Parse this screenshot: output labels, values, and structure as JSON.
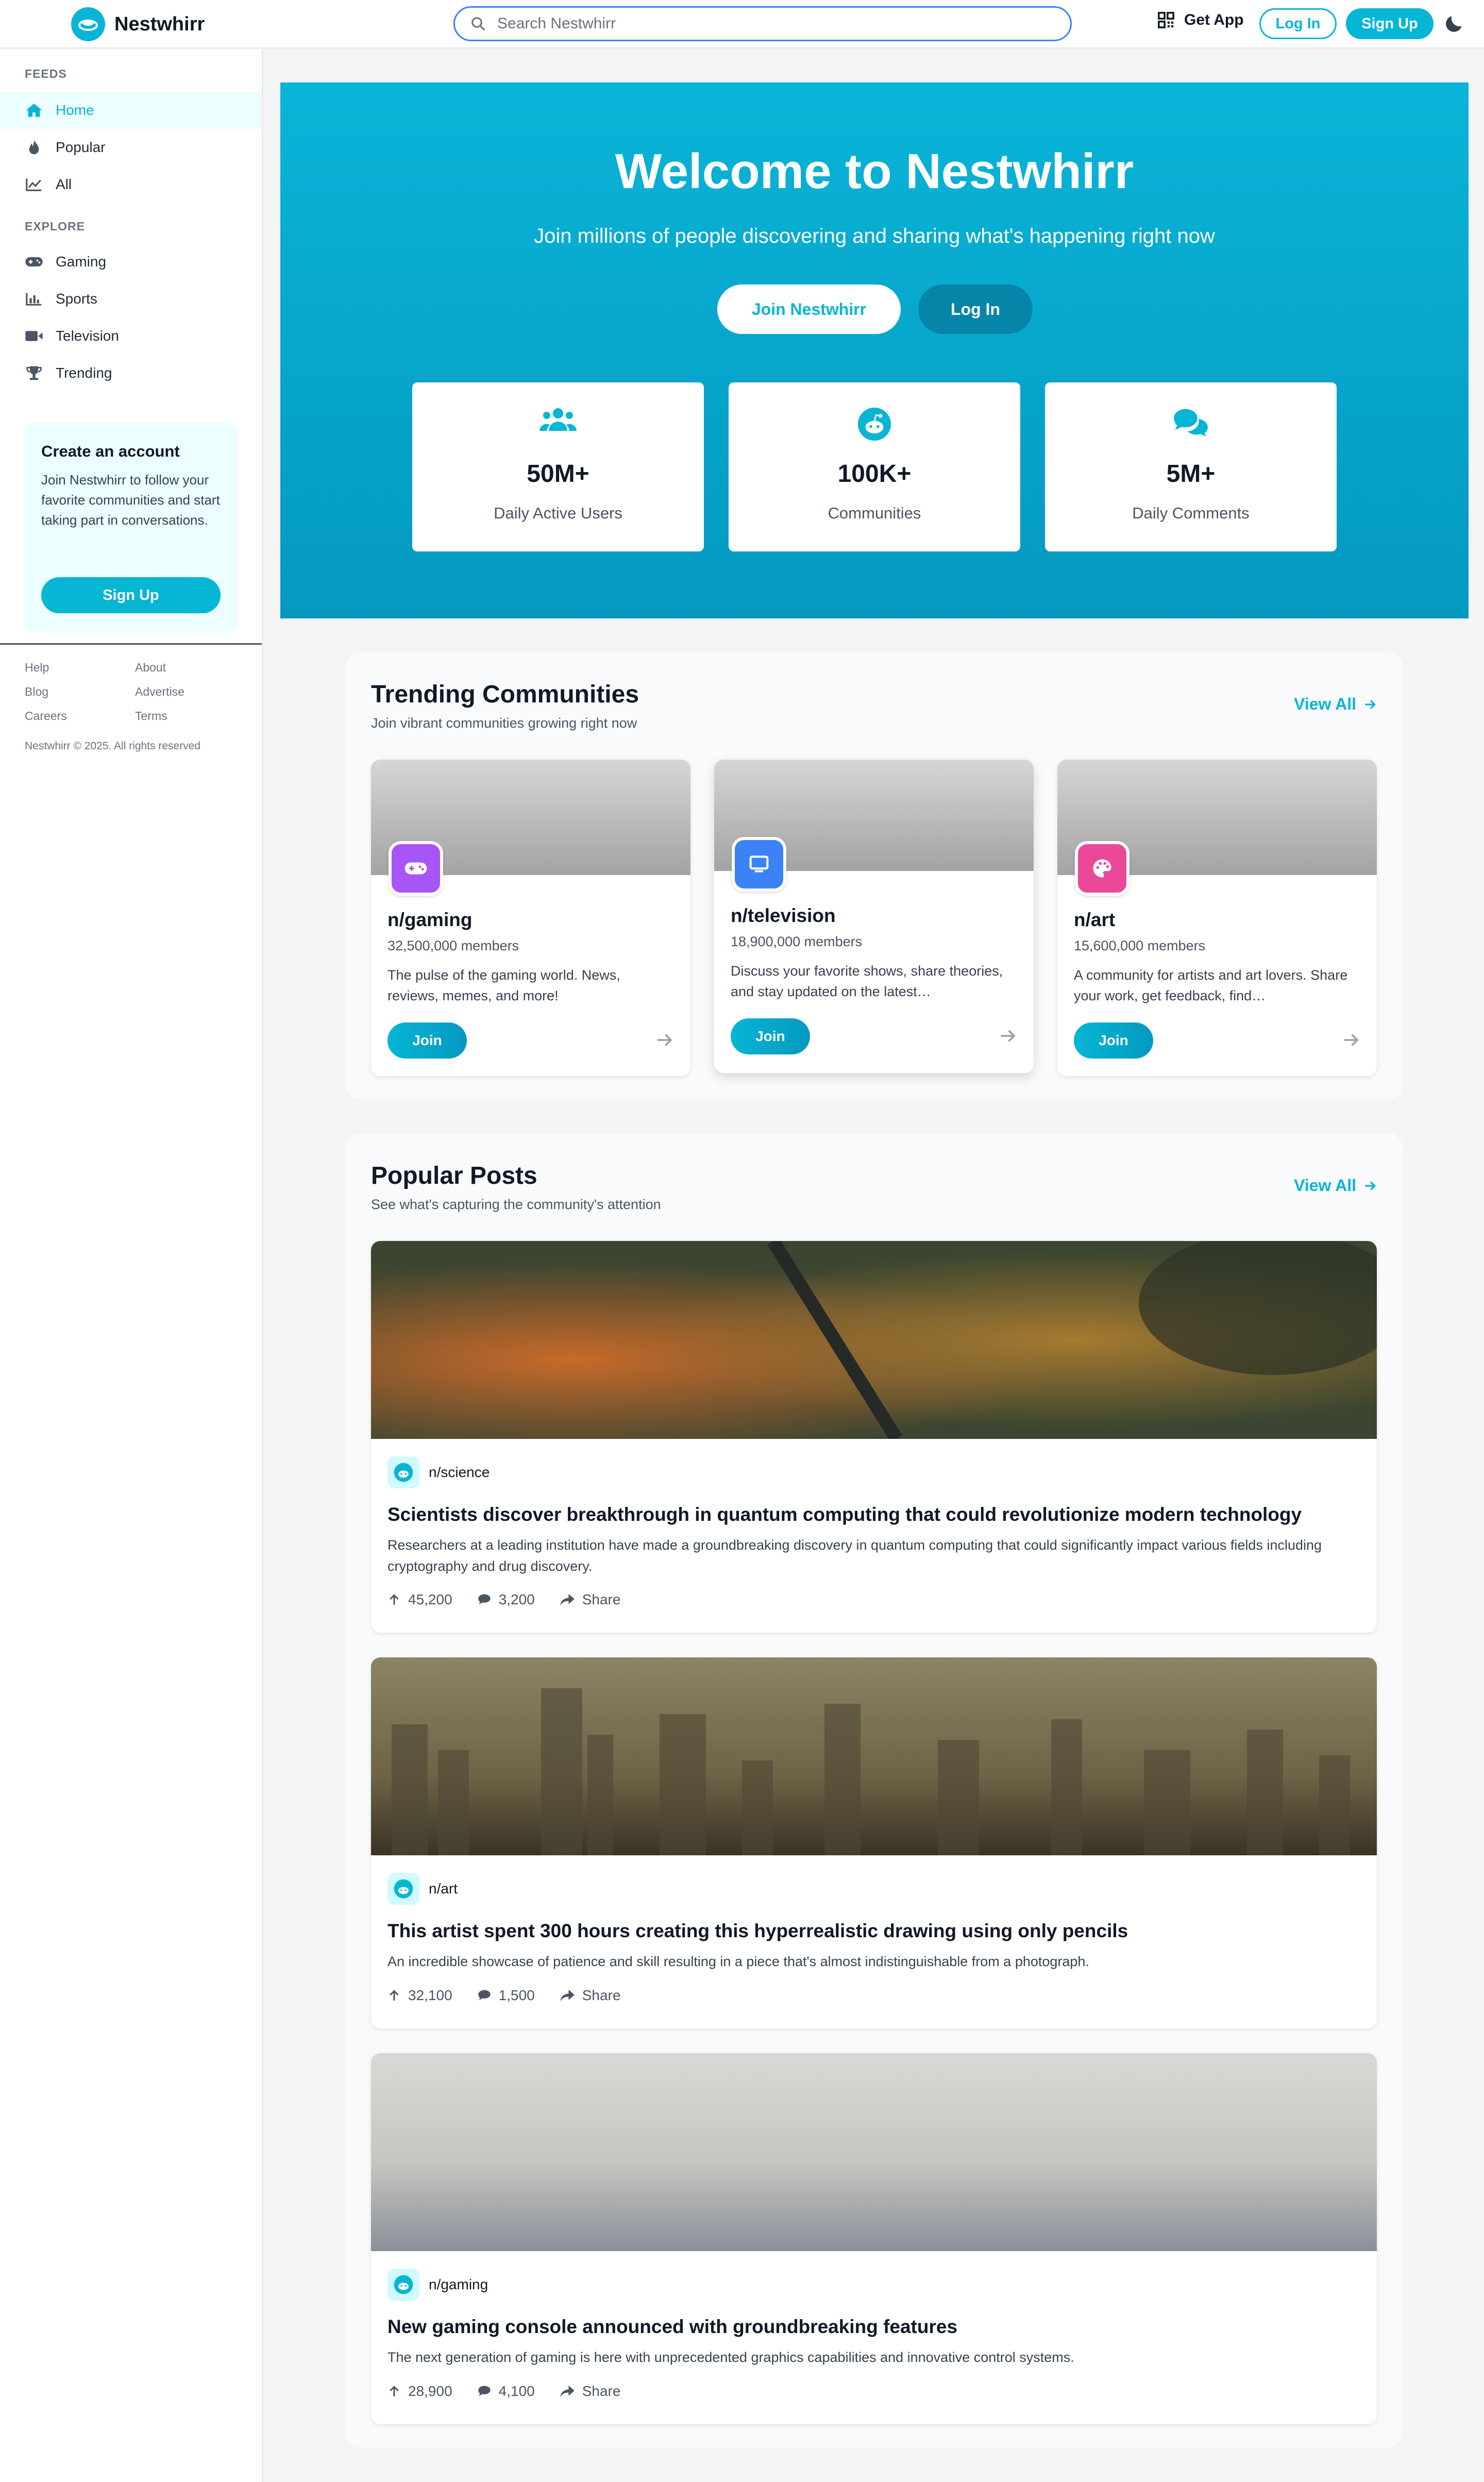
{
  "header": {
    "brand": "Nestwhirr",
    "search_placeholder": "Search Nestwhirr",
    "get_app": "Get App",
    "login": "Log In",
    "signup": "Sign Up"
  },
  "sidebar": {
    "feeds_heading": "FEEDS",
    "feeds": [
      {
        "label": "Home",
        "icon": "home-icon",
        "active": true
      },
      {
        "label": "Popular",
        "icon": "fire-icon"
      },
      {
        "label": "All",
        "icon": "chart-line-icon"
      }
    ],
    "explore_heading": "EXPLORE",
    "explore": [
      {
        "label": "Gaming",
        "icon": "gamepad-icon"
      },
      {
        "label": "Sports",
        "icon": "bar-chart-icon"
      },
      {
        "label": "Television",
        "icon": "video-icon"
      },
      {
        "label": "Trending",
        "icon": "trophy-icon"
      }
    ],
    "create_card": {
      "title": "Create an account",
      "text": "Join Nestwhirr to follow your favorite communities and start taking part in conversations.",
      "button": "Sign Up"
    },
    "footer_links": [
      "Help",
      "About",
      "Blog",
      "Advertise",
      "Careers",
      "Terms"
    ],
    "copyright": "Nestwhirr © 2025. All rights reserved"
  },
  "hero": {
    "title": "Welcome to Nestwhirr",
    "subtitle": "Join millions of people discovering and sharing what's happening right now",
    "join_button": "Join Nestwhirr",
    "login_button": "Log In",
    "stats": [
      {
        "value": "50M+",
        "label": "Daily Active Users",
        "icon": "users-icon"
      },
      {
        "value": "100K+",
        "label": "Communities",
        "icon": "robot-icon"
      },
      {
        "value": "5M+",
        "label": "Daily Comments",
        "icon": "comments-icon"
      }
    ]
  },
  "trending": {
    "title": "Trending Communities",
    "subtitle": "Join vibrant communities growing right now",
    "view_all": "View All",
    "communities": [
      {
        "name": "n/gaming",
        "members": "32,500,000 members",
        "description": "The pulse of the gaming world. News, reviews, memes, and more!",
        "join": "Join",
        "color": "#a855f7",
        "icon": "gamepad-icon"
      },
      {
        "name": "n/television",
        "members": "18,900,000 members",
        "description": "Discuss your favorite shows, share theories, and stay updated on the latest…",
        "join": "Join",
        "color": "#3b82f6",
        "icon": "tv-icon"
      },
      {
        "name": "n/art",
        "members": "15,600,000 members",
        "description": "A community for artists and art lovers. Share your work, get feedback, find…",
        "join": "Join",
        "color": "#ec4899",
        "icon": "palette-icon"
      }
    ]
  },
  "popular": {
    "title": "Popular Posts",
    "subtitle": "See what's capturing the community's attention",
    "view_all": "View All",
    "share_label": "Share",
    "posts": [
      {
        "subreddit": "n/science",
        "title": "Scientists discover breakthrough in quantum computing that could revolutionize modern technology",
        "body": "Researchers at a leading institution have made a groundbreaking discovery in quantum computing that could significantly impact various fields including cryptography and drug discovery.",
        "upvotes": "45,200",
        "comments": "3,200"
      },
      {
        "subreddit": "n/art",
        "title": "This artist spent 300 hours creating this hyperrealistic drawing using only pencils",
        "body": "An incredible showcase of patience and skill resulting in a piece that's almost indistinguishable from a photograph.",
        "upvotes": "32,100",
        "comments": "1,500"
      },
      {
        "subreddit": "n/gaming",
        "title": "New gaming console announced with groundbreaking features",
        "body": "The next generation of gaming is here with unprecedented graphics capabilities and innovative control systems.",
        "upvotes": "28,900",
        "comments": "4,100"
      }
    ]
  }
}
